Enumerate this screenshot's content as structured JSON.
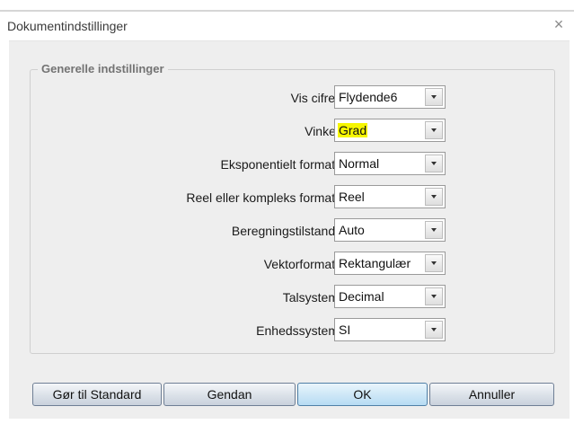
{
  "window": {
    "title": "Dokumentindstillinger",
    "close_glyph": "×"
  },
  "group": {
    "legend": "Generelle indstillinger",
    "rows": [
      {
        "label": "Vis cifre:",
        "value": "Flydende6",
        "highlighted": false
      },
      {
        "label": "Vinkel",
        "value": "Grad",
        "highlighted": true
      },
      {
        "label": "Eksponentielt format:",
        "value": "Normal",
        "highlighted": false
      },
      {
        "label": "Reel eller kompleks format:",
        "value": "Reel",
        "highlighted": false
      },
      {
        "label": "Beregningstilstand:",
        "value": "Auto",
        "highlighted": false
      },
      {
        "label": "Vektorformat:",
        "value": "Rektangulær",
        "highlighted": false
      },
      {
        "label": "Talsystem",
        "value": "Decimal",
        "highlighted": false
      },
      {
        "label": "Enhedssystem",
        "value": "SI",
        "highlighted": false
      }
    ]
  },
  "buttons": {
    "default_label": "Gør til Standard",
    "restore_label": "Gendan",
    "ok_label": "OK",
    "cancel_label": "Annuller"
  },
  "colors": {
    "highlight": "#f6f600",
    "dialog_bg": "#eeeeee"
  }
}
